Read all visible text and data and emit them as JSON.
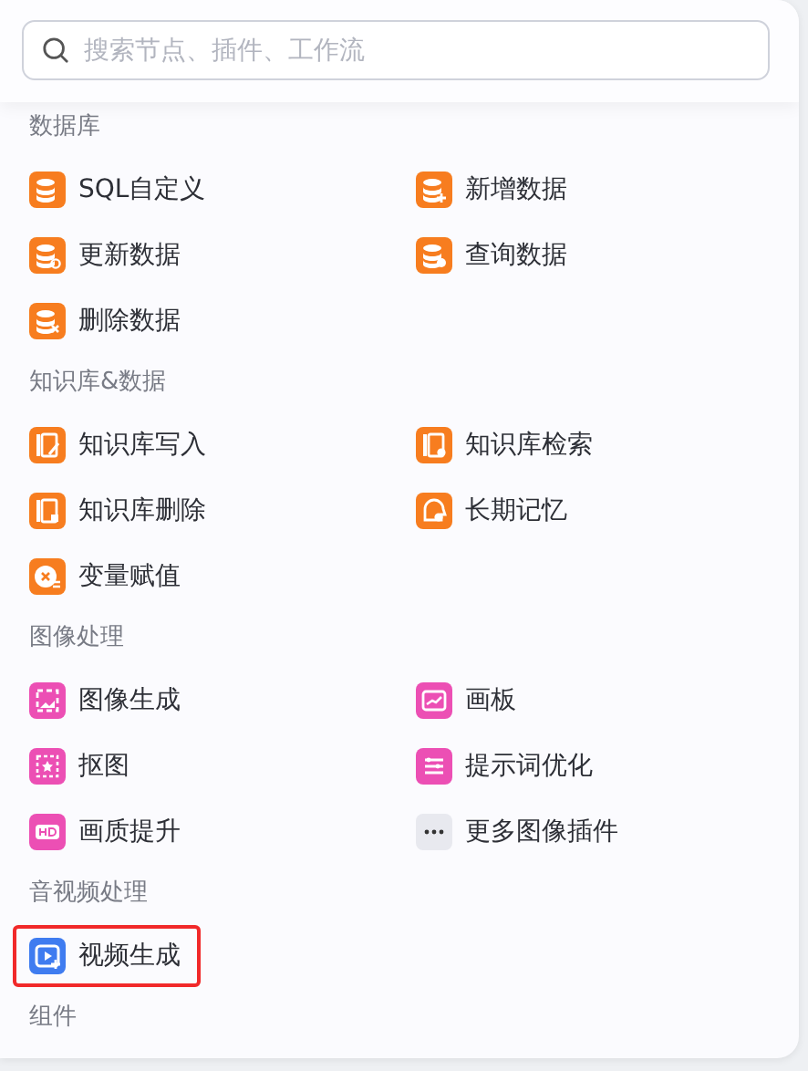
{
  "search": {
    "placeholder": "搜索节点、插件、工作流"
  },
  "sections": [
    {
      "title": "数据库",
      "items": [
        {
          "label": "SQL自定义",
          "highlighted": false
        },
        {
          "label": "新增数据",
          "highlighted": false
        },
        {
          "label": "更新数据",
          "highlighted": false
        },
        {
          "label": "查询数据",
          "highlighted": false
        },
        {
          "label": "删除数据",
          "highlighted": false
        }
      ]
    },
    {
      "title": "知识库&数据",
      "items": [
        {
          "label": "知识库写入",
          "highlighted": false
        },
        {
          "label": "知识库检索",
          "highlighted": false
        },
        {
          "label": "知识库删除",
          "highlighted": false
        },
        {
          "label": "长期记忆",
          "highlighted": false
        },
        {
          "label": "变量赋值",
          "highlighted": false
        }
      ]
    },
    {
      "title": "图像处理",
      "items": [
        {
          "label": "图像生成",
          "highlighted": false
        },
        {
          "label": "画板",
          "highlighted": false
        },
        {
          "label": "抠图",
          "highlighted": false
        },
        {
          "label": "提示词优化",
          "highlighted": false
        },
        {
          "label": "画质提升",
          "highlighted": false
        },
        {
          "label": "更多图像插件",
          "highlighted": false
        }
      ]
    },
    {
      "title": "音视频处理",
      "items": [
        {
          "label": "视频生成",
          "highlighted": true
        }
      ]
    },
    {
      "title": "组件"
    }
  ]
}
